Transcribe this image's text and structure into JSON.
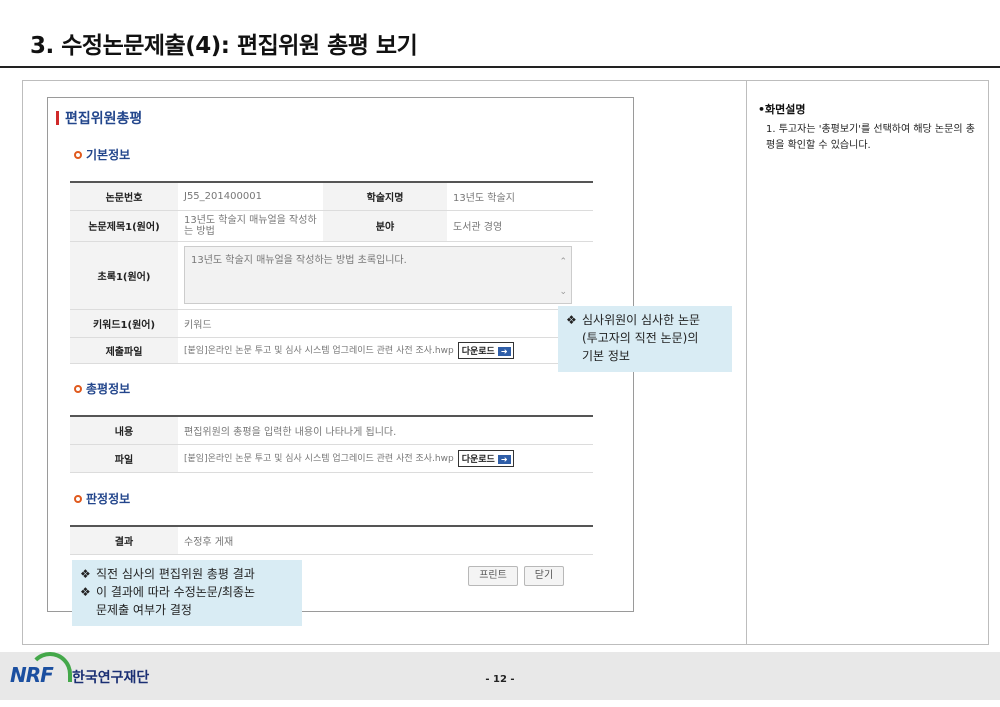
{
  "slide_title": "3. 수정논문제출(4): 편집위원 총평 보기",
  "screen": {
    "title": "편집위원총평",
    "sections": {
      "basic": "기본정보",
      "review": "총평정보",
      "decision": "판정정보"
    },
    "basic_info": {
      "paper_no_label": "논문번호",
      "paper_no_value": "J55_201400001",
      "journal_label": "학술지명",
      "journal_value": "13년도 학술지",
      "paper_title_label": "논문제목1(원어)",
      "paper_title_value": "13년도 학술지 매뉴얼을 작성하는 방법",
      "field_label": "분야",
      "field_value": "도서관 경영",
      "abstract_label": "초록1(원어)",
      "abstract_value": "13년도 학술지 매뉴얼을 작성하는 방법 초록입니다.",
      "keyword_label": "키워드1(원어)",
      "keyword_value": "키워드",
      "file_label": "제출파일",
      "file_value": "[붙임]온라인 논문 투고 및 심사 시스템 업그레이드 관련 사전 조사.hwp"
    },
    "review_info": {
      "content_label": "내용",
      "content_value": "편집위원의 총평을 입력한 내용이 나타나게 됩니다.",
      "file_label": "파일",
      "file_value": "[붙임]온라인 논문 투고 및 심사 시스템 업그레이드 관련 사전 조사.hwp"
    },
    "decision_info": {
      "result_label": "결과",
      "result_value": "수정후 게재"
    },
    "download_label": "다운로드",
    "print_button": "프린트",
    "close_button": "닫기"
  },
  "callouts": {
    "top": [
      "심사위원이 심사한 논문",
      "(투고자의 직전 논문)의",
      "기본 정보"
    ],
    "bottom": [
      "직전 심사의 편집위원 총평 결과",
      "이 결과에 따라 수정논문/최종논",
      "문제출 여부가 결정"
    ]
  },
  "right_panel": {
    "heading": "•화면설명",
    "items": [
      "1. 투고자는 '총평보기'를 선택하여 해당 논문의 총평을 확인할 수 있습니다."
    ]
  },
  "footer": {
    "logo_text": "NRF",
    "org_name": "한국연구재단",
    "page": "- 12 -"
  },
  "colors": {
    "accent": "#23468c",
    "callout_bg": "#d9ecf4",
    "bullet": "#e05a1e"
  }
}
